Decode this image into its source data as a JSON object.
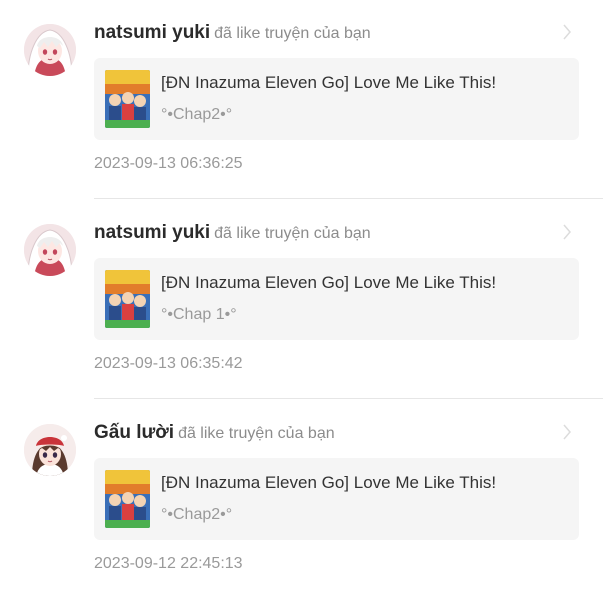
{
  "notifications": [
    {
      "username": "natsumi yuki",
      "action": "đã like truyện của bạn",
      "avatar_icon": "anime-girl-white-hood-avatar",
      "story_title": "[ĐN Inazuma Eleven Go] Love Me Like This!",
      "chapter": "°•Chap2•°",
      "timestamp": "2023-09-13 06:36:25"
    },
    {
      "username": "natsumi yuki",
      "action": "đã like truyện của bạn",
      "avatar_icon": "anime-girl-white-hood-avatar",
      "story_title": "[ĐN Inazuma Eleven Go] Love Me Like This!",
      "chapter": "°•Chap 1•°",
      "timestamp": "2023-09-13 06:35:42"
    },
    {
      "username": "Gấu lười",
      "action": "đã like truyện của bạn",
      "avatar_icon": "anime-girl-red-hat-avatar",
      "story_title": "[ĐN Inazuma Eleven Go] Love Me Like This!",
      "chapter": "°•Chap2•°",
      "timestamp": "2023-09-12 22:45:13"
    }
  ],
  "colors": {
    "username": "#2b2b2b",
    "muted_text": "#9a9a9a",
    "card_background": "#f5f5f5",
    "divider": "#e6e6e6"
  }
}
